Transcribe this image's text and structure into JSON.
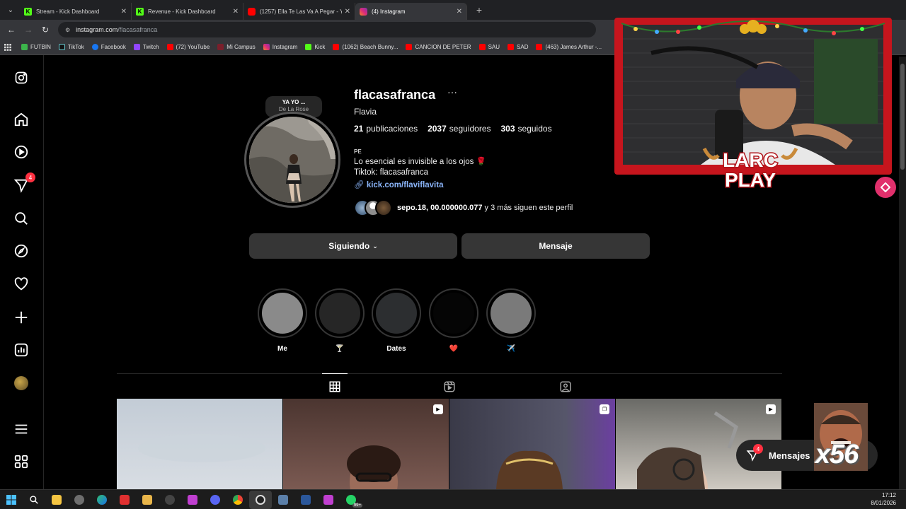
{
  "browser": {
    "tabs": [
      {
        "title": "Stream - Kick Dashboard",
        "icon": "kick-icon",
        "color": "#53fc18"
      },
      {
        "title": "Revenue - Kick Dashboard",
        "icon": "kick-icon",
        "color": "#53fc18"
      },
      {
        "title": "(1257) Ella Te Las Va A Pegar - Y",
        "icon": "youtube-icon",
        "color": "#ff0000"
      },
      {
        "title": "(4) Instagram",
        "icon": "instagram-icon",
        "color": "#e1306c"
      }
    ],
    "url_host": "instagram.com",
    "url_path": "/flacasafranca",
    "bookmarks": [
      "FUTBIN",
      "TikTok",
      "Facebook",
      "Twitch",
      "(72) YouTube",
      "Mi Campus",
      "Instagram",
      "Kick",
      "(1062) Beach Bunny...",
      "CANCION DE PETER",
      "SAU",
      "SAD",
      "(463) James Arthur -..."
    ]
  },
  "sidebar": {
    "notification_badge": "4"
  },
  "profile": {
    "note_song": "YA YO ...",
    "note_artist": "De La Rose",
    "username": "flacasafranca",
    "more": "···",
    "full_name": "Flavia",
    "posts_count": "21",
    "posts_label": "publicaciones",
    "followers_count": "2037",
    "followers_label": "seguidores",
    "following_count": "303",
    "following_label": "seguidos",
    "pronoun": "PE",
    "bio_line1": "Lo esencial es invisible a los ojos 🌹",
    "bio_line2": "Tiktok: flacasafranca",
    "link": "kick.com/flaviflavita",
    "followed_by_names": "sepo.18, 00.000000.077",
    "followed_by_rest": "y 3 más siguen este perfil",
    "following_button": "Siguiendo",
    "message_button": "Mensaje"
  },
  "highlights": [
    {
      "label": "Me",
      "color": "#8a8a8a"
    },
    {
      "label": "🍸",
      "color": "#262626"
    },
    {
      "label": "Dates",
      "color": "#2c2e30"
    },
    {
      "label": "❤️",
      "color": "#050505"
    },
    {
      "label": "✈️",
      "color": "#7a7a7a"
    }
  ],
  "overlay": {
    "logo_line1": "LARC",
    "logo_line2": "PLAY",
    "messages_label": "Mensajes",
    "messages_badge": "4",
    "multiplier": "x56"
  },
  "taskbar": {
    "time": "17:12",
    "date": "8/01/2026",
    "whatsapp_badge": "99+"
  },
  "colors": {
    "accent_link": "#8ab4f8",
    "badge": "#ff3040",
    "frame_red": "#c6151d"
  }
}
